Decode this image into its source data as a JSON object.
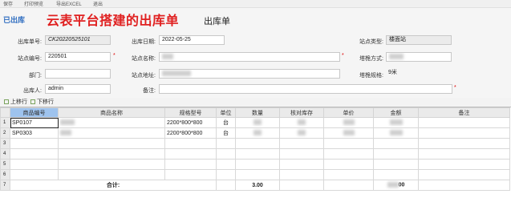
{
  "topbar": {
    "items": [
      "保存",
      "打印预览",
      "导出EXCEL",
      "退出"
    ]
  },
  "header": {
    "status": "已出库",
    "headline": "云表平台搭建的出库单",
    "doc_title": "出库单"
  },
  "form": {
    "order_no_label": "出库单号:",
    "order_no_value": "CK20220525101",
    "date_label": "出库日期:",
    "date_value": "2022-05-25",
    "site_type_label": "站点类型:",
    "site_type_value": "楼面站",
    "site_no_label": "站点编号:",
    "site_no_value": "220501",
    "site_name_label": "站点名称:",
    "tower_label": "塔桅方式:",
    "dept_label": "部门:",
    "site_addr_label": "站点地址:",
    "tower_spec_label": "塔桅规格:",
    "tower_spec_value": "9米",
    "operator_label": "出库人:",
    "operator_value": "admin",
    "remark_label": "备注:",
    "required_mark": "*"
  },
  "toolbar": {
    "row_up": "上移行",
    "row_down": "下移行"
  },
  "grid": {
    "headers": [
      "",
      "商品编号",
      "商品名称",
      "规格型号",
      "单位",
      "数量",
      "核对库存",
      "单价",
      "金额",
      "备注"
    ],
    "rows": [
      {
        "num": "1",
        "code": "SP0107",
        "spec": "2200*800*800",
        "unit": "台"
      },
      {
        "num": "2",
        "code": "SP0303",
        "spec": "2200*800*800",
        "unit": "台"
      },
      {
        "num": "3",
        "code": "",
        "spec": "",
        "unit": ""
      },
      {
        "num": "4",
        "code": "",
        "spec": "",
        "unit": ""
      },
      {
        "num": "5",
        "code": "",
        "spec": "",
        "unit": ""
      },
      {
        "num": "6",
        "code": "",
        "spec": "",
        "unit": ""
      }
    ],
    "total_row": {
      "num": "7",
      "label": "合计:",
      "qty": "3.00",
      "amount_suffix": "00"
    }
  },
  "colors": {
    "status": "#2d6cc0",
    "headline": "#e02020",
    "active_header": "#9ec3ee",
    "required": "#dd0000"
  }
}
